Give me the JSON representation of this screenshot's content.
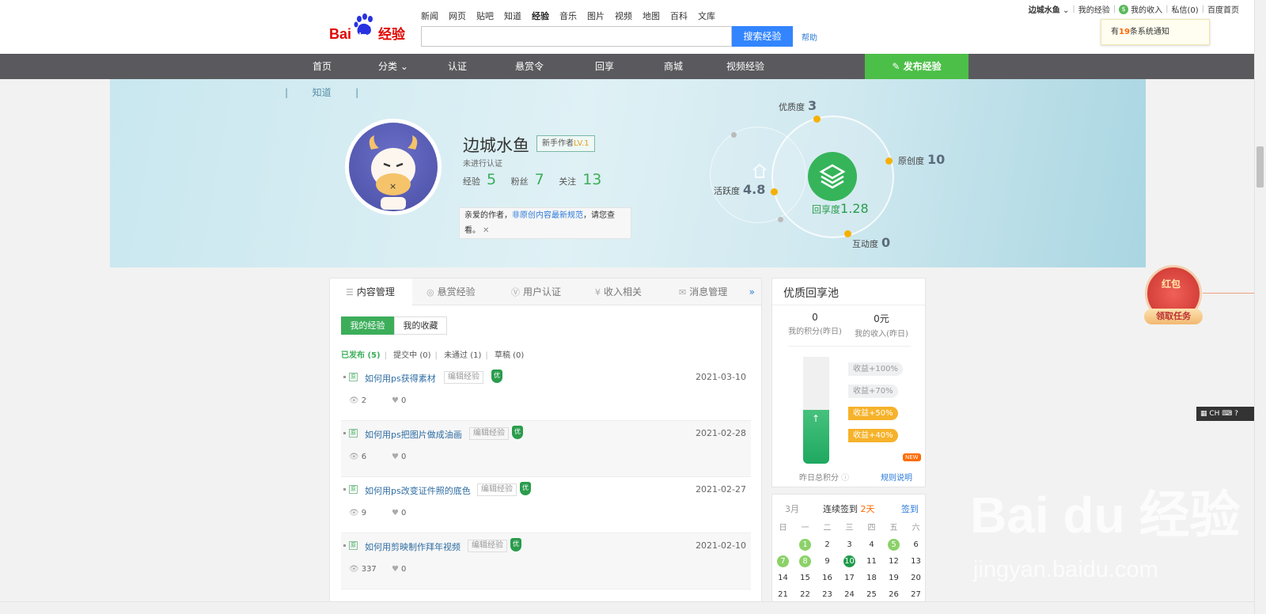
{
  "header": {
    "logo_text": "Bai du 经验",
    "topnav": [
      "新闻",
      "网页",
      "贴吧",
      "知道",
      "经验",
      "音乐",
      "图片",
      "视频",
      "地图",
      "百科",
      "文库"
    ],
    "active_nav": "经验",
    "search_placeholder": "",
    "search_button": "搜索经验",
    "help": "帮助",
    "user": {
      "name": "边城水鱼",
      "my_exp": "我的经验",
      "income": "我的收入",
      "messages": "私信(0)",
      "home": "百度首页"
    },
    "notice": {
      "prefix": "有",
      "count": "19",
      "suffix": "条系统通知"
    }
  },
  "mainnav": {
    "items": [
      "首页",
      "分类",
      "认证",
      "悬赏令",
      "回享",
      "商城",
      "视频经验"
    ],
    "publish": "发布经验"
  },
  "banner": {
    "crumb": "知道",
    "username": "边城水鱼",
    "rank": {
      "label": "新手作者",
      "level": "LV.1"
    },
    "cert_status": "未进行认证",
    "stats": [
      {
        "label": "经验",
        "value": "5"
      },
      {
        "label": "粉丝",
        "value": "7"
      },
      {
        "label": "关注",
        "value": "13"
      }
    ],
    "tip": {
      "pre": "亲爱的作者，",
      "link": "非原创内容最新规范",
      "post": "，请您查看。"
    },
    "radar": {
      "quality": {
        "label": "优质度",
        "value": "3"
      },
      "originality": {
        "label": "原创度",
        "value": "10"
      },
      "activity": {
        "label": "活跃度",
        "value": "4.8"
      },
      "interaction": {
        "label": "互动度",
        "value": "0"
      },
      "share": {
        "label": "回享度",
        "value": "1.28"
      }
    }
  },
  "content": {
    "tabs": [
      "内容管理",
      "悬赏经验",
      "用户认证",
      "收入相关",
      "消息管理"
    ],
    "tab_more": "»",
    "subtabs": [
      "我的经验",
      "我的收藏"
    ],
    "filters": [
      {
        "label": "已发布 (5)"
      },
      {
        "label": "提交中 (0)"
      },
      {
        "label": "未通过 (1)"
      },
      {
        "label": "草稿 (0)"
      }
    ],
    "edit_label": "编辑经验",
    "badge_label": "优",
    "yuan_label": "原",
    "items": [
      {
        "title": "如何用ps获得素材",
        "date": "2021-03-10",
        "views": "2",
        "likes": "0"
      },
      {
        "title": "如何用ps把图片做成油画",
        "date": "2021-02-28",
        "views": "6",
        "likes": "0"
      },
      {
        "title": "如何用ps改变证件照的底色",
        "date": "2021-02-27",
        "views": "9",
        "likes": "0"
      },
      {
        "title": "如何用剪映制作拜年视频",
        "date": "2021-02-10",
        "views": "337",
        "likes": "0"
      }
    ]
  },
  "pool": {
    "title": "优质回享池",
    "points": {
      "value": "0",
      "label": "我的积分(昨日)"
    },
    "income": {
      "value": "0元",
      "label": "我的收入(昨日)"
    },
    "levels": [
      "收益+100%",
      "收益+70%",
      "收益+50%",
      "收益+40%"
    ],
    "fill_fraction": 0.5,
    "new_badge": "NEW",
    "footer_left": "昨日总积分",
    "footer_right": "规则说明"
  },
  "calendar": {
    "month": "3月",
    "streak_pre": "连续签到",
    "streak": "2天",
    "sign": "签到",
    "weekdays": [
      "日",
      "一",
      "二",
      "三",
      "四",
      "五",
      "六"
    ],
    "weeks": [
      [
        "",
        "1",
        "2",
        "3",
        "4",
        "5",
        "6"
      ],
      [
        "7",
        "8",
        "9",
        "10",
        "11",
        "12",
        "13"
      ],
      [
        "14",
        "15",
        "16",
        "17",
        "18",
        "19",
        "20"
      ],
      [
        "21",
        "22",
        "23",
        "24",
        "25",
        "26",
        "27"
      ]
    ],
    "signed_light": [
      "1",
      "5",
      "7",
      "8"
    ],
    "signed_dark": [
      "10"
    ]
  },
  "floating": {
    "redpack_title": "红包",
    "redpack_button": "领取任务",
    "ime": "CH"
  },
  "watermark": {
    "main": "Bai du 经验",
    "sub": "jingyan.baidu.com"
  },
  "colors": {
    "brand_green": "#3cae5a",
    "nav_bg": "#5a5a5e",
    "search_blue": "#3385ff",
    "accent_gold": "#f6b000"
  }
}
